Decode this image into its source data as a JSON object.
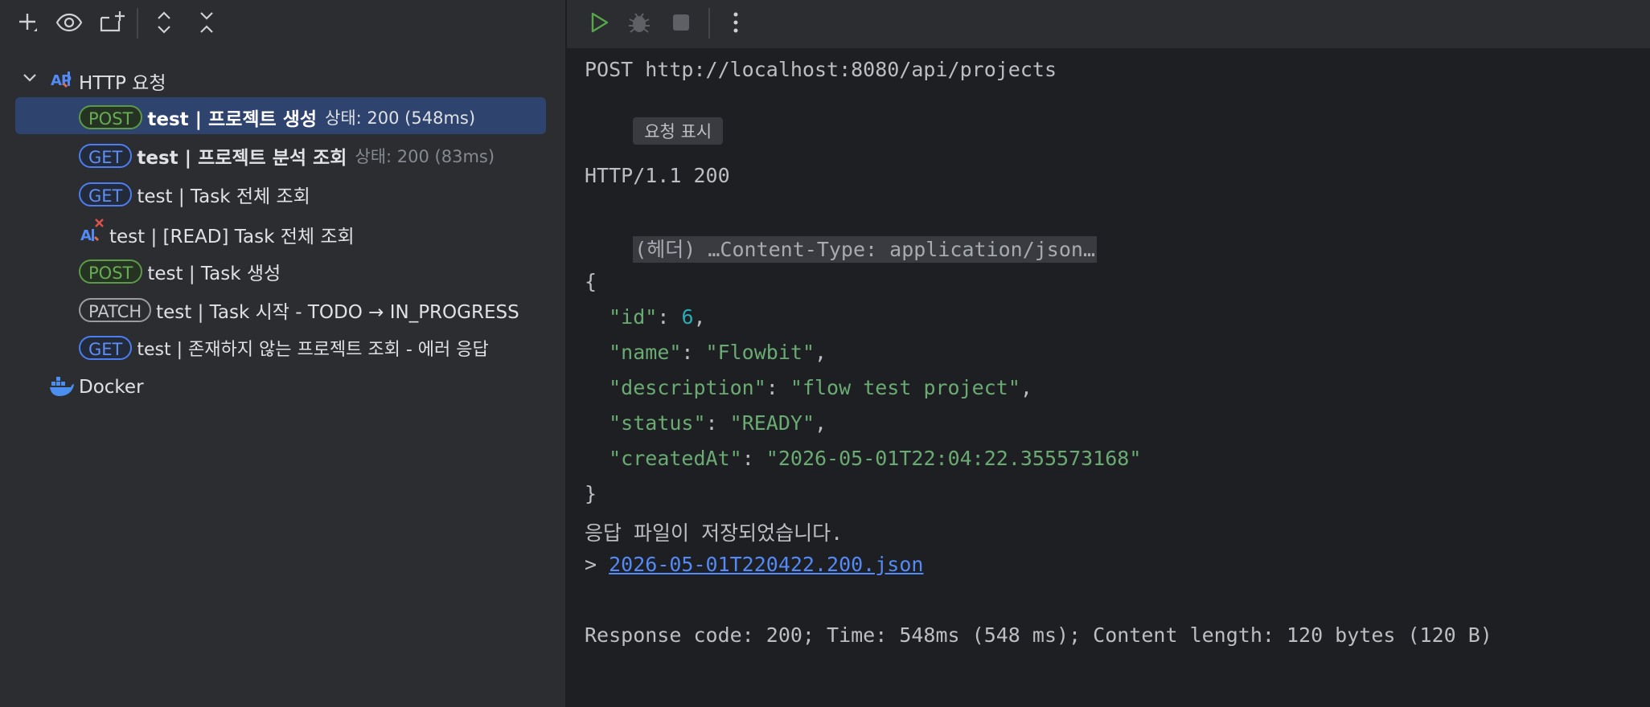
{
  "left_toolbar": {
    "icons": [
      "add-icon",
      "eye-icon",
      "new-folder-icon",
      "expand-all-icon",
      "collapse-all-icon"
    ]
  },
  "tree": {
    "root_label": "HTTP 요청",
    "items": [
      {
        "method": "POST",
        "name": "test  |  프로젝트 생성",
        "status": "상태: 200 (548ms)",
        "bold": true,
        "selected": true
      },
      {
        "method": "GET",
        "name": "test  |  프로젝트 분석 조회",
        "status": "상태: 200 (83ms)",
        "bold": true,
        "selected": false
      },
      {
        "method": "GET",
        "name": "test  |  Task 전체 조회",
        "status": "",
        "bold": false,
        "selected": false
      },
      {
        "method": "",
        "name": "test | [READ] Task 전체 조회",
        "status": "",
        "bold": false,
        "selected": false
      },
      {
        "method": "POST",
        "name": "test  |  Task 생성",
        "status": "",
        "bold": false,
        "selected": false
      },
      {
        "method": "PATCH",
        "name": "test  |  Task 시작 - TODO → IN_PROGRESS",
        "status": "",
        "bold": false,
        "selected": false
      },
      {
        "method": "GET",
        "name": "test  |  존재하지 않는 프로젝트 조회 - 에러 응답",
        "status": "",
        "bold": false,
        "selected": false
      }
    ],
    "docker_label": "Docker"
  },
  "right_toolbar": {
    "icons": [
      "run-icon",
      "debug-icon",
      "stop-icon",
      "more-icon"
    ]
  },
  "console": {
    "request_line": "POST http://localhost:8080/api/projects",
    "show_request_label": "요청 표시",
    "status_line": "HTTP/1.1 200",
    "headers_folded": "(헤더) …Content-Type: application/json…",
    "body_open": "{",
    "fields": [
      {
        "key": "\"id\"",
        "value": "6",
        "type": "number",
        "comma": ","
      },
      {
        "key": "\"name\"",
        "value": "\"Flowbit\"",
        "type": "string",
        "comma": ","
      },
      {
        "key": "\"description\"",
        "value": "\"flow test project\"",
        "type": "string",
        "comma": ","
      },
      {
        "key": "\"status\"",
        "value": "\"READY\"",
        "type": "string",
        "comma": ","
      },
      {
        "key": "\"createdAt\"",
        "value": "\"2026-05-01T22:04:22.355573168\"",
        "type": "string",
        "comma": ""
      }
    ],
    "body_close": "}",
    "saved_message": "응답 파일이 저장되었습니다.",
    "saved_prefix": "> ",
    "saved_file": "2026-05-01T220422.200.json",
    "summary": "Response code: 200; Time: 548ms (548 ms); Content length: 120 bytes (120 B)"
  },
  "colors": {
    "selection": "#2e436e",
    "post": "#6aab56",
    "get": "#5f8ff5",
    "string": "#6aab73",
    "number": "#2aacb8",
    "link": "#548af7"
  }
}
